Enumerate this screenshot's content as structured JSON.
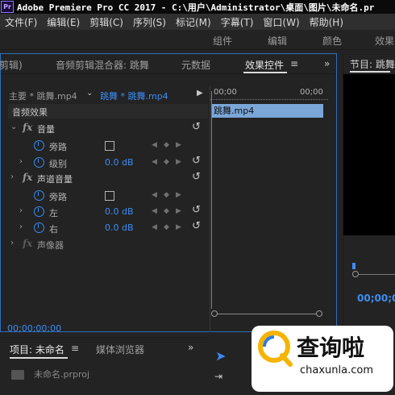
{
  "window": {
    "logo": "Pr",
    "title": "Adobe Premiere Pro CC 2017 - C:\\用户\\Administrator\\桌面\\图片\\未命名.pr"
  },
  "menu": [
    "文件(F)",
    "编辑(E)",
    "剪辑(C)",
    "序列(S)",
    "标记(M)",
    "字幕(T)",
    "窗口(W)",
    "帮助(H)"
  ],
  "workspaces": [
    "组件",
    "编辑",
    "颜色",
    "效果"
  ],
  "effect_panel": {
    "tabs": [
      "剪辑)",
      "音频剪辑混合器: 跳舞",
      "元数据",
      "效果控件"
    ],
    "tab_menu": "≡",
    "overflow": "»",
    "master_label": "主要 * 跳舞.mp4",
    "clip_label": "跳舞 * 跳舞.mp4",
    "section_title": "音频效果",
    "timeline_start": "00;00",
    "timeline_end": "00;00",
    "clip_name": "跳舞.mp4",
    "current_time": "00;00;00;00",
    "effects": {
      "volume": "音量",
      "bypass": "旁路",
      "level": "级别",
      "level_value": "0.0 dB",
      "channel_volume": "声道音量",
      "bypass2": "旁路",
      "left": "左",
      "left_value": "0.0 dB",
      "right": "右",
      "right_value": "0.0 dB",
      "panner": "声像器"
    }
  },
  "program_panel": {
    "title": "节目: 跳舞",
    "timecode": "00;00;0"
  },
  "project_panel": {
    "tab": "项目: 未命名",
    "tab_menu": "≡",
    "media_browser": "媒体浏览器",
    "overflow": "»",
    "file": "未命名.prproj"
  },
  "watermark": {
    "brand": "查询啦",
    "url": "chaxunla.com"
  },
  "colors": {
    "accent_blue": "#3b8cf2",
    "clip_blue": "#7aa6d8",
    "bg": "#232323"
  }
}
